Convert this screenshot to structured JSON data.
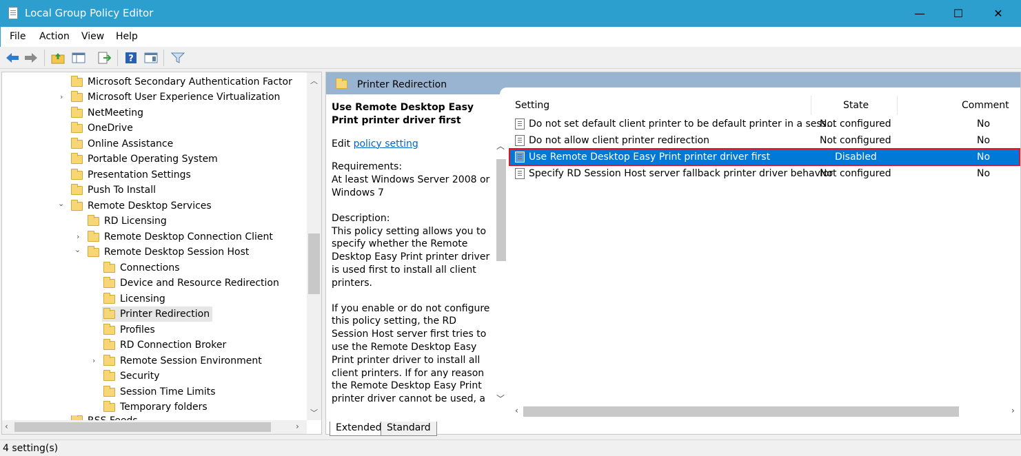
{
  "window": {
    "title": "Local Group Policy Editor",
    "minimize": "—",
    "maximize": "☐",
    "close": "✕"
  },
  "menu": [
    "File",
    "Action",
    "View",
    "Help"
  ],
  "toolbar": {
    "icons": [
      "back-arrow-icon",
      "forward-arrow-icon",
      "up-folder-icon",
      "show-hide-tree-icon",
      "export-list-icon",
      "help-icon",
      "properties-icon",
      "filter-icon"
    ]
  },
  "tree": {
    "items": [
      {
        "label": "Microsoft Secondary Authentication Factor",
        "chevron": ""
      },
      {
        "label": "Microsoft User Experience Virtualization",
        "chevron": "›"
      },
      {
        "label": "NetMeeting",
        "chevron": ""
      },
      {
        "label": "OneDrive",
        "chevron": ""
      },
      {
        "label": "Online Assistance",
        "chevron": ""
      },
      {
        "label": "Portable Operating System",
        "chevron": ""
      },
      {
        "label": "Presentation Settings",
        "chevron": ""
      },
      {
        "label": "Push To Install",
        "chevron": ""
      },
      {
        "label": "Remote Desktop Services",
        "chevron": "⌄"
      },
      {
        "label": "RD Licensing",
        "chevron": ""
      },
      {
        "label": "Remote Desktop Connection Client",
        "chevron": "›"
      },
      {
        "label": "Remote Desktop Session Host",
        "chevron": "⌄"
      },
      {
        "label": "Connections",
        "chevron": ""
      },
      {
        "label": "Device and Resource Redirection",
        "chevron": ""
      },
      {
        "label": "Licensing",
        "chevron": ""
      },
      {
        "label": "Printer Redirection",
        "chevron": ""
      },
      {
        "label": "Profiles",
        "chevron": ""
      },
      {
        "label": "RD Connection Broker",
        "chevron": ""
      },
      {
        "label": "Remote Session Environment",
        "chevron": "›"
      },
      {
        "label": "Security",
        "chevron": ""
      },
      {
        "label": "Session Time Limits",
        "chevron": ""
      },
      {
        "label": "Temporary folders",
        "chevron": ""
      },
      {
        "label": "RSS Feeds",
        "chevron": ""
      }
    ]
  },
  "right": {
    "header": "Printer Redirection",
    "desc": {
      "heading": "Use Remote Desktop Easy Print printer driver first",
      "edit_prefix": "Edit ",
      "edit_link": "policy setting",
      "req_label": "Requirements:",
      "req_text": "At least Windows Server 2008 or Windows 7",
      "desc_label": "Description:",
      "desc_text": "This policy setting allows you to specify whether the Remote Desktop Easy Print printer driver is used first to install all client printers.",
      "more_text": "If you enable or do not configure this policy setting, the RD Session Host server first tries to use the Remote Desktop Easy Print printer driver to install all client printers. If for any reason the Remote Desktop Easy Print printer driver cannot be used, a printer driver on the RD Session Host server that"
    },
    "columns": {
      "setting": "Setting",
      "state": "State",
      "comment": "Comment"
    },
    "rows": [
      {
        "setting": "Do not set default client printer to be default printer in a sess...",
        "state": "Not configured",
        "comment": "No"
      },
      {
        "setting": "Do not allow client printer redirection",
        "state": "Not configured",
        "comment": "No"
      },
      {
        "setting": "Use Remote Desktop Easy Print printer driver first",
        "state": "Disabled",
        "comment": "No"
      },
      {
        "setting": "Specify RD Session Host server fallback printer driver behavior",
        "state": "Not configured",
        "comment": "No"
      }
    ]
  },
  "tabs": {
    "extended": "Extended",
    "standard": "Standard"
  },
  "status": "4 setting(s)"
}
